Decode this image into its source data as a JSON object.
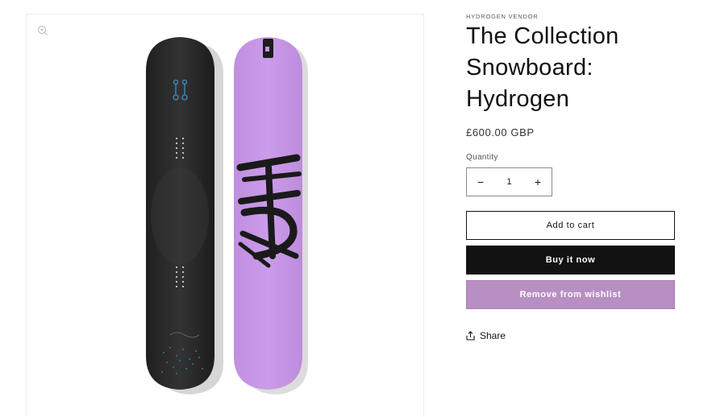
{
  "product": {
    "vendor": "HYDROGEN VENDOR",
    "title": "The Collection Snowboard: Hydrogen",
    "price": "£600.00 GBP",
    "quantity_label": "Quantity",
    "quantity_value": "1",
    "decrease_symbol": "−",
    "increase_symbol": "+"
  },
  "actions": {
    "add_to_cart": "Add to cart",
    "buy_now": "Buy it now",
    "wishlist": "Remove from wishlist",
    "share": "Share"
  },
  "colors": {
    "board_dark": "#2b2b2b",
    "board_purple": "#c695e6",
    "wishlist_button": "#b88fc2",
    "buy_button": "#121212"
  },
  "icons": {
    "zoom": "zoom-icon",
    "share": "share-icon"
  }
}
